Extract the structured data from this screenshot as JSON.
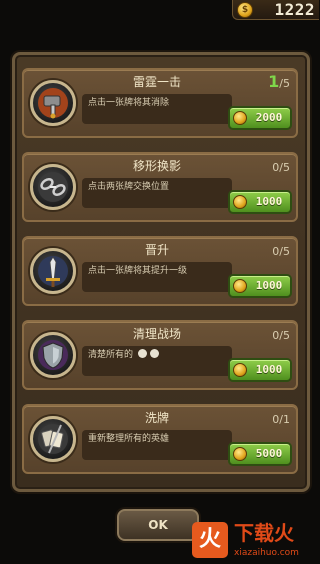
{
  "coins": {
    "icon": "coin-icon",
    "amount": "1222"
  },
  "items": [
    {
      "title": "雷霆一击",
      "count_current": "1",
      "count_total": "/5",
      "desc": "点击一张牌将其消除",
      "price": "2000",
      "icon": "hammer-icon"
    },
    {
      "title": "移形换影",
      "count_current": "",
      "count_total": "0/5",
      "desc": "点击两张牌交换位置",
      "price": "1000",
      "icon": "chain-icon"
    },
    {
      "title": "晋升",
      "count_current": "",
      "count_total": "0/5",
      "desc": "点击一张牌将其提升一级",
      "price": "1000",
      "icon": "sword-icon"
    },
    {
      "title": "清理战场",
      "count_current": "",
      "count_total": "0/5",
      "desc": "清楚所有的",
      "price": "1000",
      "icon": "shield-icon"
    },
    {
      "title": "洗牌",
      "count_current": "",
      "count_total": "0/1",
      "desc": "重新整理所有的英雄",
      "price": "5000",
      "icon": "shuffle-icon"
    }
  ],
  "ok_label": "OK",
  "watermark": {
    "logo": "火",
    "name": "下载火",
    "url": "xiazaihuo.com"
  },
  "colors": {
    "accent": "#6fb52e",
    "panel": "#4a3a26",
    "card": "#6b5236"
  }
}
